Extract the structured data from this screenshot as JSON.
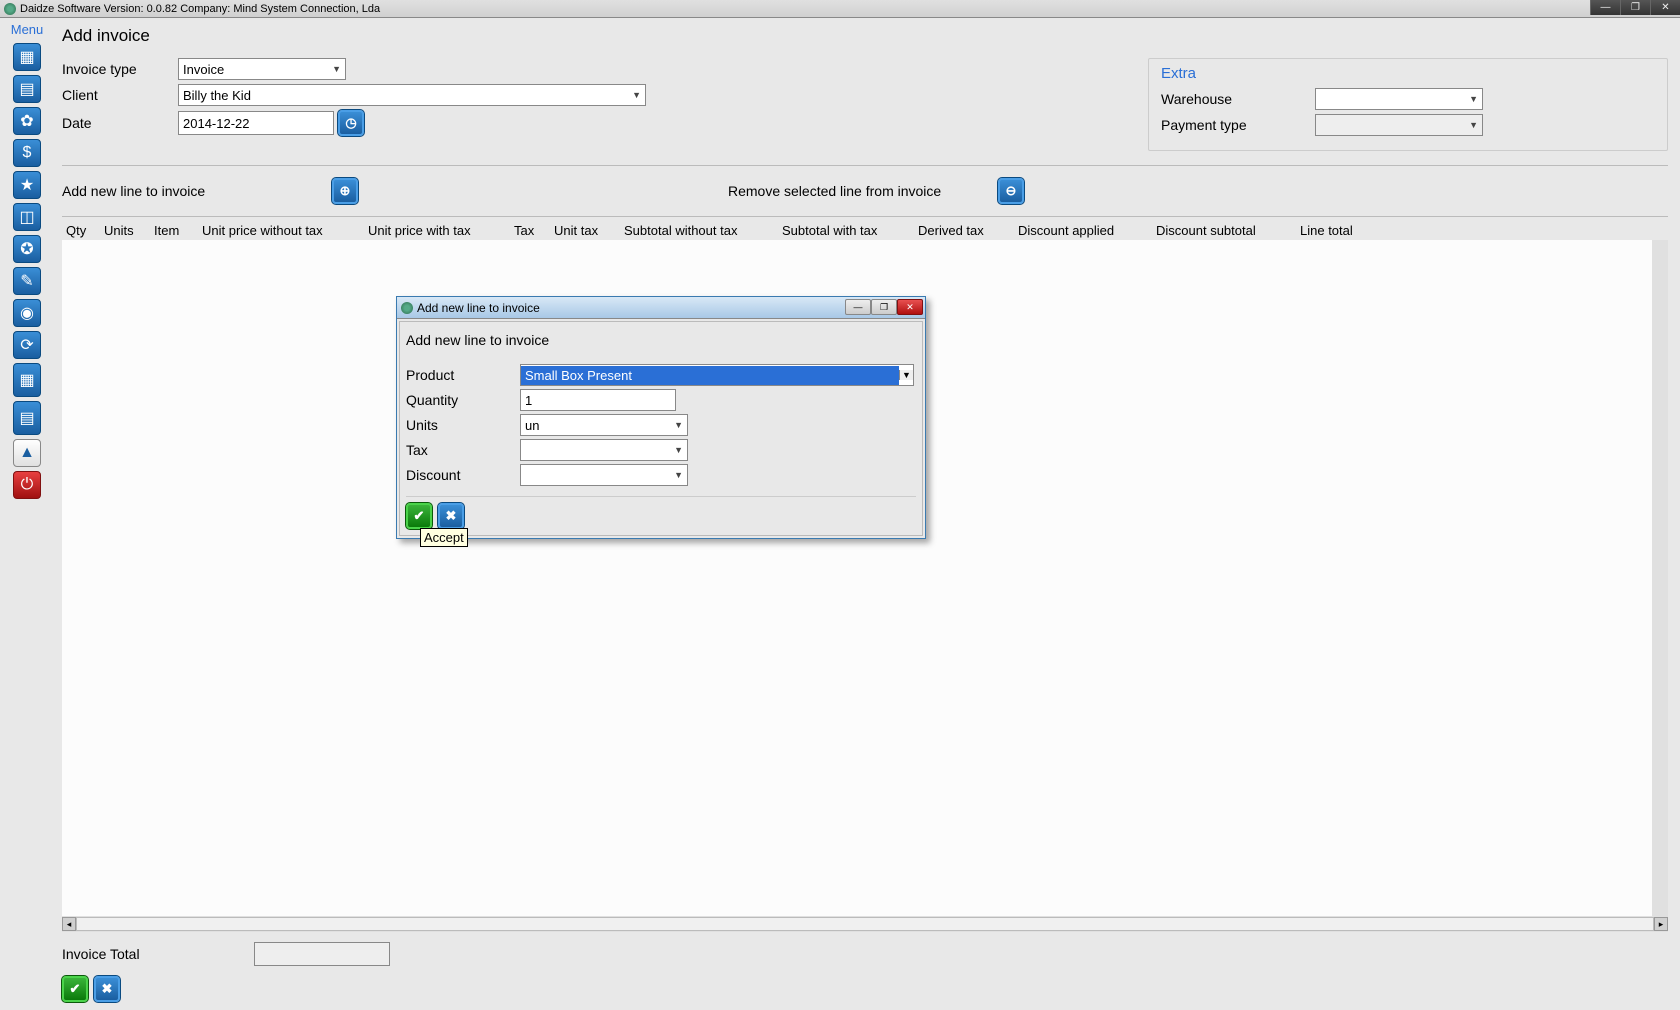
{
  "window": {
    "title": "Daidze Software Version: 0.0.82 Company: Mind System Connection, Lda"
  },
  "sidebar": {
    "menu_label": "Menu"
  },
  "page": {
    "title": "Add invoice",
    "invoice_type_label": "Invoice type",
    "invoice_type_value": "Invoice",
    "client_label": "Client",
    "client_value": "Billy the Kid",
    "date_label": "Date",
    "date_value": "2014-12-22",
    "extra_label": "Extra",
    "warehouse_label": "Warehouse",
    "warehouse_value": "",
    "payment_type_label": "Payment type",
    "payment_type_value": "",
    "add_line_label": "Add new line to invoice",
    "remove_line_label": "Remove selected line from invoice",
    "columns": [
      "Qty",
      "Units",
      "Item",
      "Unit price without tax",
      "Unit price with tax",
      "Tax",
      "Unit tax",
      "Subtotal without tax",
      "Subtotal with tax",
      "Derived tax",
      "Discount applied",
      "Discount subtotal",
      "Line total"
    ],
    "invoice_total_label": "Invoice Total",
    "invoice_total_value": ""
  },
  "dialog": {
    "title": "Add new line to invoice",
    "subtitle": "Add new line to invoice",
    "product_label": "Product",
    "product_value": "Small Box Present",
    "quantity_label": "Quantity",
    "quantity_value": "1",
    "units_label": "Units",
    "units_value": "un",
    "tax_label": "Tax",
    "tax_value": "",
    "discount_label": "Discount",
    "discount_value": "",
    "accept_tooltip": "Accept"
  }
}
